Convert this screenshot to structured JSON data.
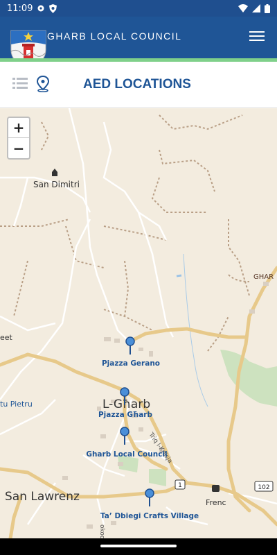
{
  "status": {
    "time": "11:09"
  },
  "header": {
    "title": "GHARB LOCAL COUNCIL"
  },
  "toolbar": {
    "title": "AED LOCATIONS"
  },
  "colors": {
    "header": "#1f5596",
    "accent_stripe": "#7fd08a",
    "map_background": "#f3ecdf",
    "marker": "#4a8fd8",
    "aed_label": "#1f5596"
  },
  "map": {
    "zoom_in": "+",
    "zoom_out": "−",
    "places": {
      "san_dimitri": "San Dimitri",
      "l_gharb": "L-Għarb",
      "san_lawrenz": "San Lawrenz",
      "frenc": "Frenc",
      "ghar_edge": "GHAR",
      "street_edge": "eet",
      "pietru_edge": "tu Pietru",
      "road_trig": "Triq l-Knisja",
      "road_1": "1",
      "road_102": "102",
      "road_fragment": "okod"
    },
    "aed_locations": [
      {
        "name": "Pjazza Gerano"
      },
      {
        "name": "Pjazza Għarb"
      },
      {
        "name": "Gharb Local Council"
      },
      {
        "name": "Ta’ Dbiegi Crafts Village"
      }
    ]
  }
}
